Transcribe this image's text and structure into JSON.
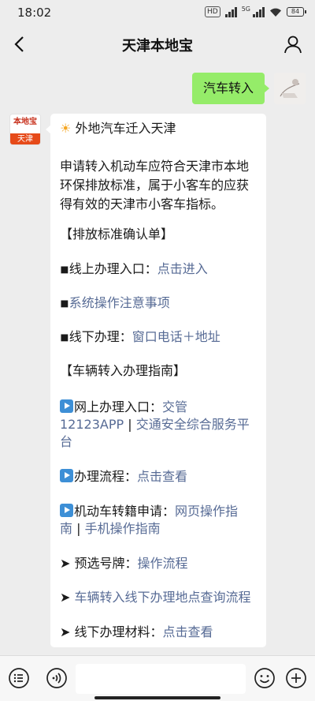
{
  "status_bar": {
    "time": "18:02",
    "hd_badge": "HD",
    "network_label": "5G",
    "battery_level": "84"
  },
  "nav": {
    "title": "天津本地宝",
    "back_icon": "chevron-left-icon",
    "profile_icon": "person-icon"
  },
  "outgoing_message": {
    "text": "汽车转入"
  },
  "account_avatar": {
    "logo_text": "本地宝",
    "city": "天津"
  },
  "reply": {
    "title_icon": "sun-icon",
    "title": "外地汽车迁入天津",
    "intro": [
      "申请转入机动车应符合天津市本地",
      "环保排放标准，属于小客车的应获",
      "得有效的天津市小客车指标。"
    ],
    "section1_heading": "【排放标准确认单】",
    "s1_item1_prefix": "◾线上办理入口：",
    "s1_item1_link": "点击进入",
    "s1_item2_prefix": "◾",
    "s1_item2_link": "系统操作注意事项",
    "s1_item3_prefix": "◾线下办理：",
    "s1_item3_link": "窗口电话＋地址",
    "section2_heading": "【车辆转入办理指南】",
    "s2_item1_prefix": "网上办理入口：",
    "s2_item1_link_a": "交管",
    "s2_item1_link_a2": "12123APP",
    "s2_item1_sep": " | ",
    "s2_item1_link_b1": "交通安全综合服务平",
    "s2_item1_link_b2": "台",
    "s2_item2_prefix": "办理流程：",
    "s2_item2_link": "点击查看",
    "s2_item3_prefix": "机动车转籍申请：",
    "s2_item3_link_a1": "网页操作指",
    "s2_item3_link_a2": "南",
    "s2_item3_sep": " | ",
    "s2_item3_link_b": "手机操作指南",
    "s2_item4_prefix": "➤ 预选号牌：",
    "s2_item4_link": "操作流程",
    "s2_item5_prefix": "➤ ",
    "s2_item5_link": "车辆转入线下办理地点查询流程",
    "s2_item6_prefix": "➤ 线下办理材料：",
    "s2_item6_link": "点击查看"
  },
  "bottom_bar": {
    "menu_icon": "list-menu-icon",
    "voice_icon": "voice-icon",
    "emoji_icon": "emoji-icon",
    "plus_icon": "plus-icon",
    "input_value": ""
  },
  "colors": {
    "link": "#576b95",
    "bubble_out": "#95ec69",
    "background": "#ededed"
  }
}
